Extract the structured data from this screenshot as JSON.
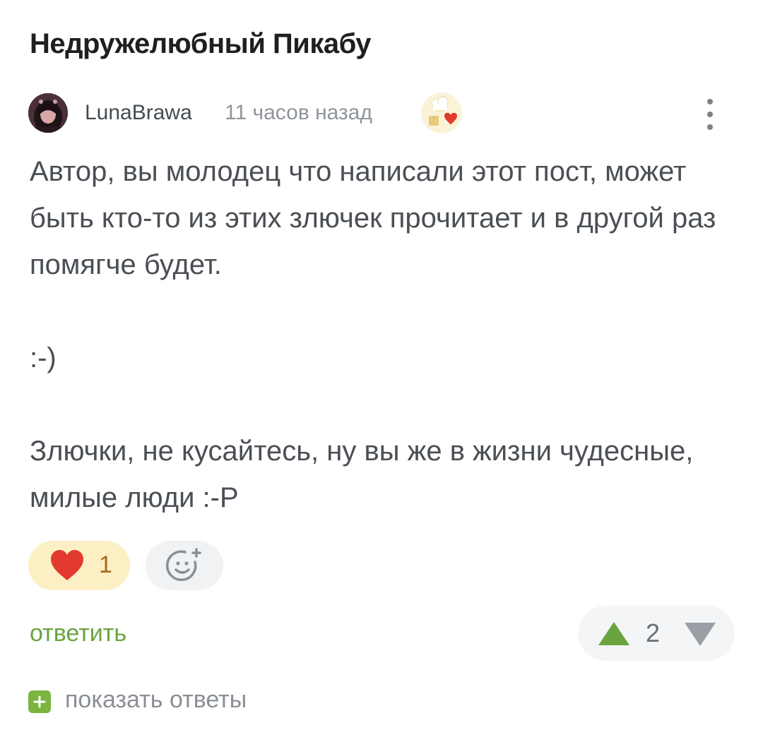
{
  "post": {
    "title": "Недружелюбный Пикабу"
  },
  "comment": {
    "author": "LunaBrawa",
    "time_ago": "11 часов назад",
    "award_icon": "chef-heart-award-icon",
    "paragraphs": [
      "Автор, вы молодец что написали этот пост, может быть кто-то из этих злючек прочитает и в другой раз помягче будет.",
      ":-)",
      "Злючки, не кусайтесь, ну вы же в жизни чудесные, милые люди :-P"
    ],
    "reactions": {
      "like_count": "1"
    },
    "reply_label": "ответить",
    "rating": "2",
    "show_replies_label": "показать ответы"
  },
  "colors": {
    "reply_green": "#6aa340",
    "upvote_green": "#6aa340",
    "downvote_gray": "#9a9fa5",
    "like_bg": "#fcefc4",
    "heart_red": "#e23a2e"
  }
}
